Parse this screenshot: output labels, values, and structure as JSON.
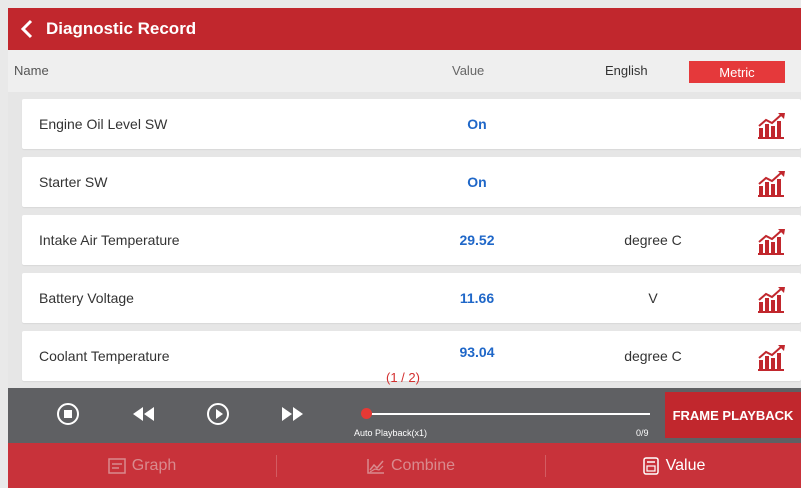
{
  "header": {
    "title": "Diagnostic Record",
    "back_icon": "chevron-left-icon"
  },
  "columns": {
    "name": "Name",
    "value": "Value",
    "english": "English",
    "metric": "Metric"
  },
  "rows": [
    {
      "name": "Engine Oil Level SW",
      "value": "On",
      "unit": ""
    },
    {
      "name": "Starter SW",
      "value": "On",
      "unit": ""
    },
    {
      "name": "Intake Air Temperature",
      "value": "29.52",
      "unit": "degree C"
    },
    {
      "name": "Battery Voltage",
      "value": "11.66",
      "unit": "V"
    },
    {
      "name": "Coolant Temperature",
      "value": "93.04",
      "unit": "degree C"
    }
  ],
  "pager": "(1 / 2)",
  "playback": {
    "auto_label": "Auto Playback(x1)",
    "count": "0/9",
    "frame_button": "FRAME PLAYBACK"
  },
  "tabs": {
    "graph": "Graph",
    "combine": "Combine",
    "value": "Value"
  },
  "colors": {
    "brand_red": "#c1272d",
    "value_blue": "#1f67c8",
    "metric_red": "#e5393b"
  }
}
